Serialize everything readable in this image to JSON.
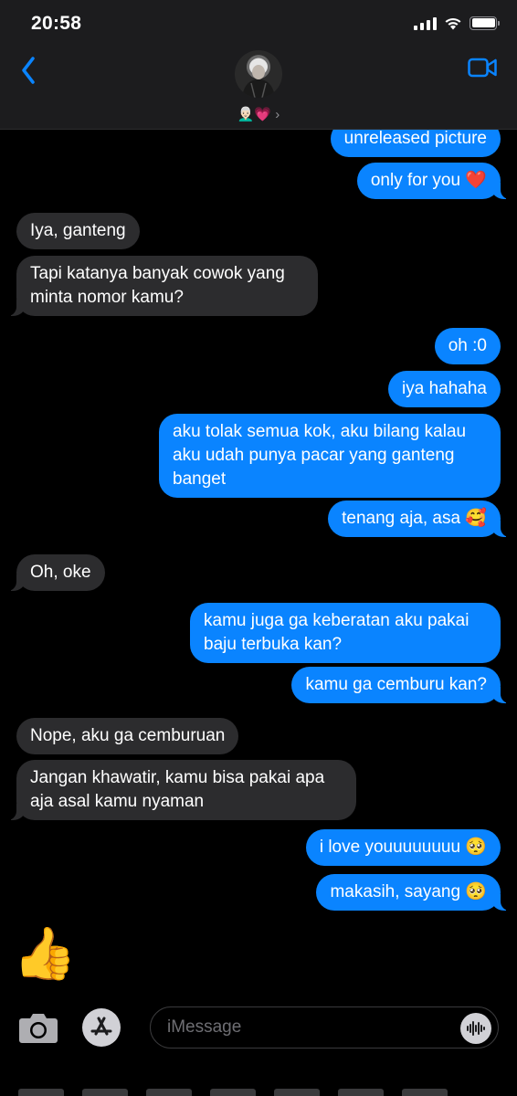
{
  "status_bar": {
    "time": "20:58"
  },
  "header": {
    "contact_name": "👨🏻‍🦳💗 ›"
  },
  "messages": [
    {
      "from": "me",
      "text": "unreleased picture"
    },
    {
      "from": "me",
      "text": "only for you ❤️"
    },
    {
      "from": "them",
      "text": "Iya, ganteng"
    },
    {
      "from": "them",
      "text": "Tapi katanya banyak cowok yang minta nomor kamu?"
    },
    {
      "from": "me",
      "text": "oh :0"
    },
    {
      "from": "me",
      "text": "iya hahaha"
    },
    {
      "from": "me",
      "text": "aku tolak semua kok, aku bilang kalau aku udah punya pacar yang ganteng banget"
    },
    {
      "from": "me",
      "text": "tenang aja, asa 🥰"
    },
    {
      "from": "them",
      "text": "Oh, oke"
    },
    {
      "from": "me",
      "text": "kamu juga ga keberatan aku pakai baju terbuka kan?"
    },
    {
      "from": "me",
      "text": "kamu ga cemburu kan?"
    },
    {
      "from": "them",
      "text": "Nope, aku ga cemburuan"
    },
    {
      "from": "them",
      "text": "Jangan khawatir, kamu bisa pakai apa aja asal kamu nyaman"
    },
    {
      "from": "me",
      "text": "i love youuuuuuuu 🥺"
    },
    {
      "from": "me",
      "text": "makasih, sayang 🥺"
    },
    {
      "from": "them",
      "text": "👍"
    }
  ],
  "input": {
    "placeholder": "iMessage"
  },
  "icons": {
    "back": "chevron-left-icon",
    "video": "video-camera-icon",
    "camera": "camera-icon",
    "apps": "app-store-icon",
    "audio": "audio-waveform-icon"
  },
  "colors": {
    "sent": "#0a84ff",
    "received": "#2c2c2e",
    "background": "#000000",
    "accent": "#0a84ff"
  }
}
